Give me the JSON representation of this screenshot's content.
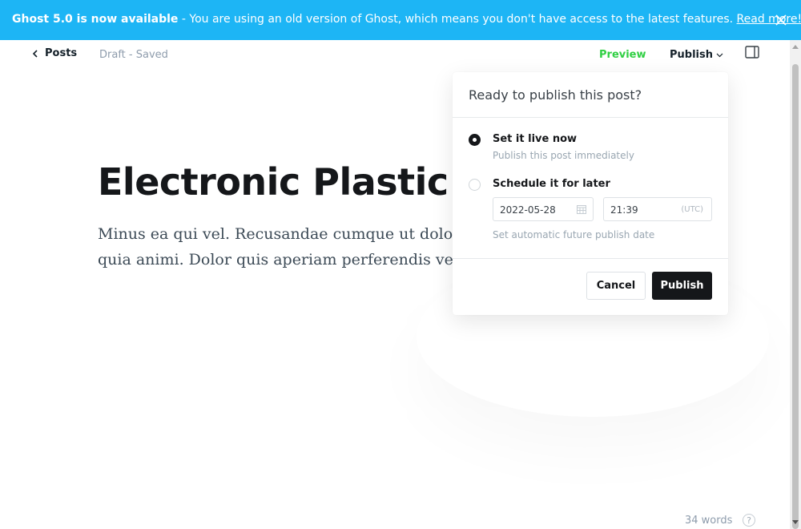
{
  "banner": {
    "headline": "Ghost 5.0 is now available",
    "message": " - You are using an old version of Ghost, which means you don't have access to the latest features. ",
    "link": "Read more!",
    "color": "#1db5f5"
  },
  "header": {
    "back_label": "Posts",
    "status": "Draft - Saved",
    "preview_label": "Preview",
    "publish_label": "Publish"
  },
  "post": {
    "title": "Electronic Plastic Sa",
    "body": "Minus ea qui vel. Recusandae cumque ut dolor. Minus quisquam qui id nam. Et quia animi. Dolor quis aperiam perferendis veritatis qui dicta."
  },
  "publish_menu": {
    "heading": "Ready to publish this post?",
    "option_now": {
      "title": "Set it live now",
      "description": "Publish this post immediately",
      "selected": true
    },
    "option_schedule": {
      "title": "Schedule it for later",
      "selected": false,
      "date": "2022-05-28",
      "time": "21:39",
      "timezone": "(UTC)",
      "hint": "Set automatic future publish date"
    },
    "cancel_label": "Cancel",
    "publish_label": "Publish"
  },
  "footer": {
    "word_count": "34 words",
    "help_label": "?"
  },
  "colors": {
    "accent_green": "#30cf43",
    "primary_dark": "#15171a"
  }
}
